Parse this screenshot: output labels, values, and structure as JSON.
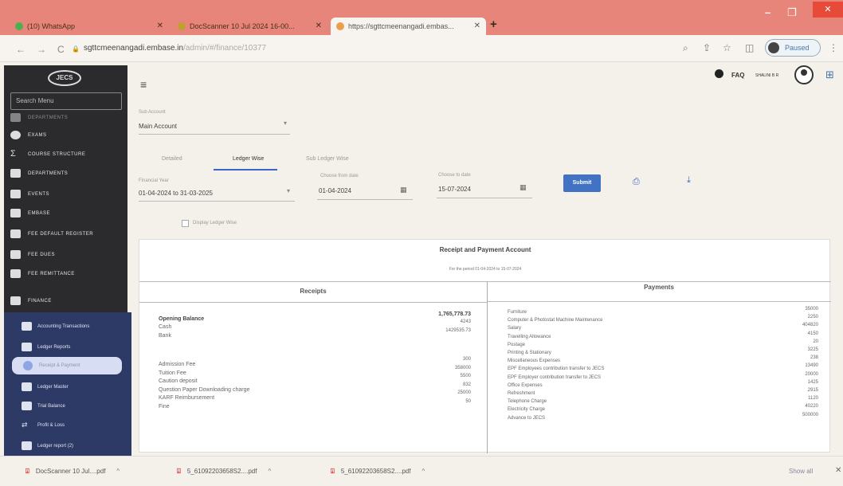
{
  "browser": {
    "tabs": [
      {
        "title": "(10) WhatsApp",
        "fav_color": "#4caf50",
        "active": false
      },
      {
        "title": "DocScanner 10 Jul 2024 16-00...",
        "fav_color": "#c0a030",
        "active": false
      },
      {
        "title": "https://sgttcmeenangadi.embas...",
        "fav_color": "#e8a050",
        "active": true
      }
    ],
    "new_tab": "+",
    "minimize": "–",
    "maximize": "❐",
    "close": "✕",
    "back": "←",
    "forward": "→",
    "reload": "C",
    "lock": "🔒",
    "url_host": "sgttcmeenangadi.embase.in",
    "url_path": "/admin/#/finance/10377",
    "zoom_icon": "⌕",
    "share_icon": "⇪",
    "star_icon": "☆",
    "sidepanel_icon": "◫",
    "profile_label": "Paused",
    "menu_icon": "⋮"
  },
  "sidebar": {
    "logo": "JECS",
    "search_placeholder": "Search Menu",
    "items": [
      {
        "label": "DEPARTMENTS",
        "top": 0
      },
      {
        "label": "EXAMS"
      },
      {
        "label": "COURSE STRUCTURE"
      },
      {
        "label": "DEPARTMENTS"
      },
      {
        "label": "EVENTS"
      },
      {
        "label": "EMBASE"
      },
      {
        "label": "FEE DEFAULT REGISTER"
      },
      {
        "label": "FEE DUES"
      },
      {
        "label": "FEE REMITTANCE"
      },
      {
        "label": "FINANCE"
      }
    ],
    "sub_items": [
      {
        "label": "Accounting Transactions"
      },
      {
        "label": "Ledger Reports"
      },
      {
        "label": "Receipt & Payment",
        "active": true
      },
      {
        "label": "Ledger Master"
      },
      {
        "label": "Trial Balance"
      },
      {
        "label": "Profit & Loss"
      },
      {
        "label": "Ledger report (2)"
      }
    ]
  },
  "topbar": {
    "menu_icon": "≡",
    "faq": "FAQ",
    "user": "SHALINI B R",
    "apps_icon": "⊞"
  },
  "form": {
    "account_label": "Sub Account",
    "account_value": "Main Account",
    "tabs": [
      "Detailed",
      "Ledger Wise",
      "Sub Ledger Wise"
    ],
    "active_tab": "Ledger Wise",
    "fy_label": "Financial Year",
    "fy_value": "01-04-2024 to 31-03-2025",
    "from_label": "Choose from date",
    "from_value": "01-04-2024",
    "to_label": "Choose to date",
    "to_value": "15-07-2024",
    "submit": "Submit",
    "print_icon": "⎙",
    "download_icon": "⤓",
    "calendar_icon": "▦",
    "dropdown_icon": "▾",
    "checkbox_label": "Display Ledger Wise"
  },
  "report": {
    "title": "Receipt and Payment Account",
    "subtitle": "For the period 01-04-2024 to 15-07-2024",
    "receipts_head": "Receipts",
    "payments_head": "Payments",
    "receipts": [
      {
        "label": "Opening Balance",
        "value": "1,765,778.73",
        "bold": true
      },
      {
        "label": "Cash",
        "value": "4243"
      },
      {
        "label": "Bank",
        "value": "1429535.73"
      },
      {
        "label": "Admission Fee",
        "value": "300"
      },
      {
        "label": "Tuition Fee",
        "value": "358000"
      },
      {
        "label": "Caution deposit",
        "value": "5500"
      },
      {
        "label": "Question Paper Downloading charge",
        "value": "832"
      },
      {
        "label": "KARF Reimbursement",
        "value": "25000"
      },
      {
        "label": "Fine",
        "value": "50"
      }
    ],
    "payments": [
      {
        "label": "Furniture",
        "value": "35000"
      },
      {
        "label": "Computer & Photostat Machine Maintenance",
        "value": "2250"
      },
      {
        "label": "Salary",
        "value": "404820"
      },
      {
        "label": "Travelling Allowance",
        "value": "4150"
      },
      {
        "label": "Postage",
        "value": "20"
      },
      {
        "label": "Printing & Stationary",
        "value": "3225"
      },
      {
        "label": "Miscellaneous Expenses",
        "value": "238"
      },
      {
        "label": "EPF Employees contribution transfer to JECS",
        "value": "13490"
      },
      {
        "label": "EPF Employer contribution transfer to JECS",
        "value": "20000"
      },
      {
        "label": "Office Expenses",
        "value": "1425"
      },
      {
        "label": "Refreshment",
        "value": "2915"
      },
      {
        "label": "Telephone Charge",
        "value": "1120"
      },
      {
        "label": "Electricity Charge",
        "value": "40220"
      },
      {
        "label": "Advance to JECS",
        "value": "500000"
      }
    ]
  },
  "downloads": {
    "items": [
      {
        "name": "DocScanner 10 Jul....pdf"
      },
      {
        "name": "5_61092203658S2....pdf"
      },
      {
        "name": "5_61092203658S2....pdf"
      }
    ],
    "pdf_icon": "⍗",
    "chevron": "^",
    "show_all": "Show all",
    "close": "✕"
  }
}
